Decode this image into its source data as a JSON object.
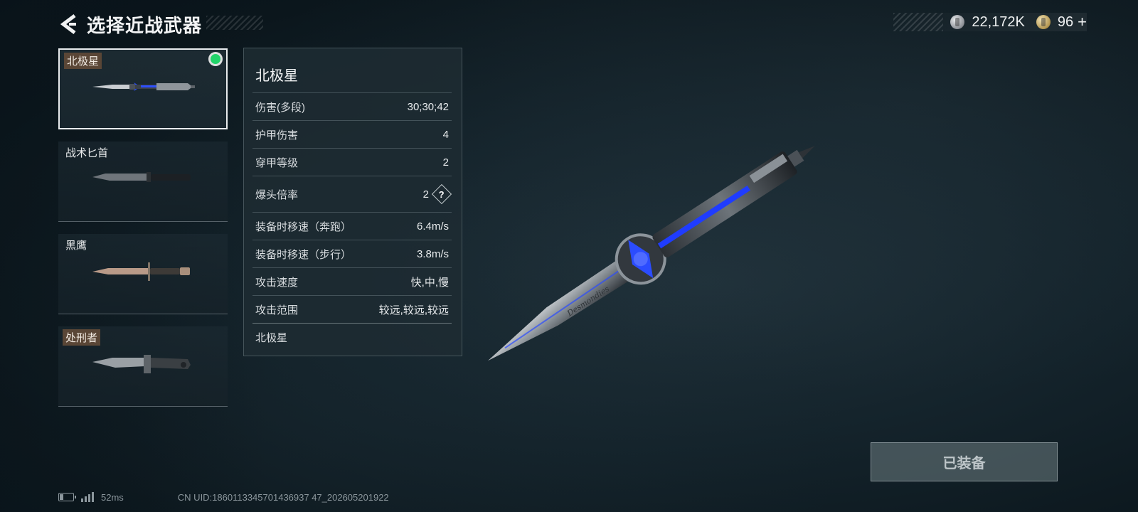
{
  "header": {
    "title": "选择近战武器",
    "back_icon": "chevron-left-icon"
  },
  "currency": {
    "silver_value": "22,172K",
    "silver_icon": "silver-coin-icon",
    "gold_value": "96",
    "gold_icon": "gold-coin-icon",
    "add_label": "+"
  },
  "weapon_list": [
    {
      "label": "北极星",
      "tagged": true,
      "selected": true,
      "equipped": true
    },
    {
      "label": "战术匕首",
      "tagged": false,
      "selected": false,
      "equipped": false
    },
    {
      "label": "黑鹰",
      "tagged": false,
      "selected": false,
      "equipped": false
    },
    {
      "label": "处刑者",
      "tagged": true,
      "selected": false,
      "equipped": false
    }
  ],
  "stats": {
    "title": "北极星",
    "rows": [
      {
        "label": "伤害(多段)",
        "value": "30;30;42"
      },
      {
        "label": "护甲伤害",
        "value": "4"
      },
      {
        "label": "穿甲等级",
        "value": "2"
      },
      {
        "label": "爆头倍率",
        "value": "2"
      },
      {
        "label": "装备时移速（奔跑）",
        "value": "6.4m/s"
      },
      {
        "label": "装备时移速（步行）",
        "value": "3.8m/s"
      },
      {
        "label": "攻击速度",
        "value": "快,中,慢"
      },
      {
        "label": "攻击范围",
        "value": "较远,较远,较远"
      }
    ],
    "help_label": "?",
    "footer": "北极星"
  },
  "main_knife": {
    "engraving": "Desmondies"
  },
  "equip_button": {
    "label": "已装备"
  },
  "status": {
    "ping": "52ms",
    "uid": "CN UID:1860113345701436937 47_202605201922"
  },
  "colors": {
    "equipped_dot": "#22d36a",
    "accent_blue": "#2b4cff",
    "tag_bg": "#5a4636"
  }
}
